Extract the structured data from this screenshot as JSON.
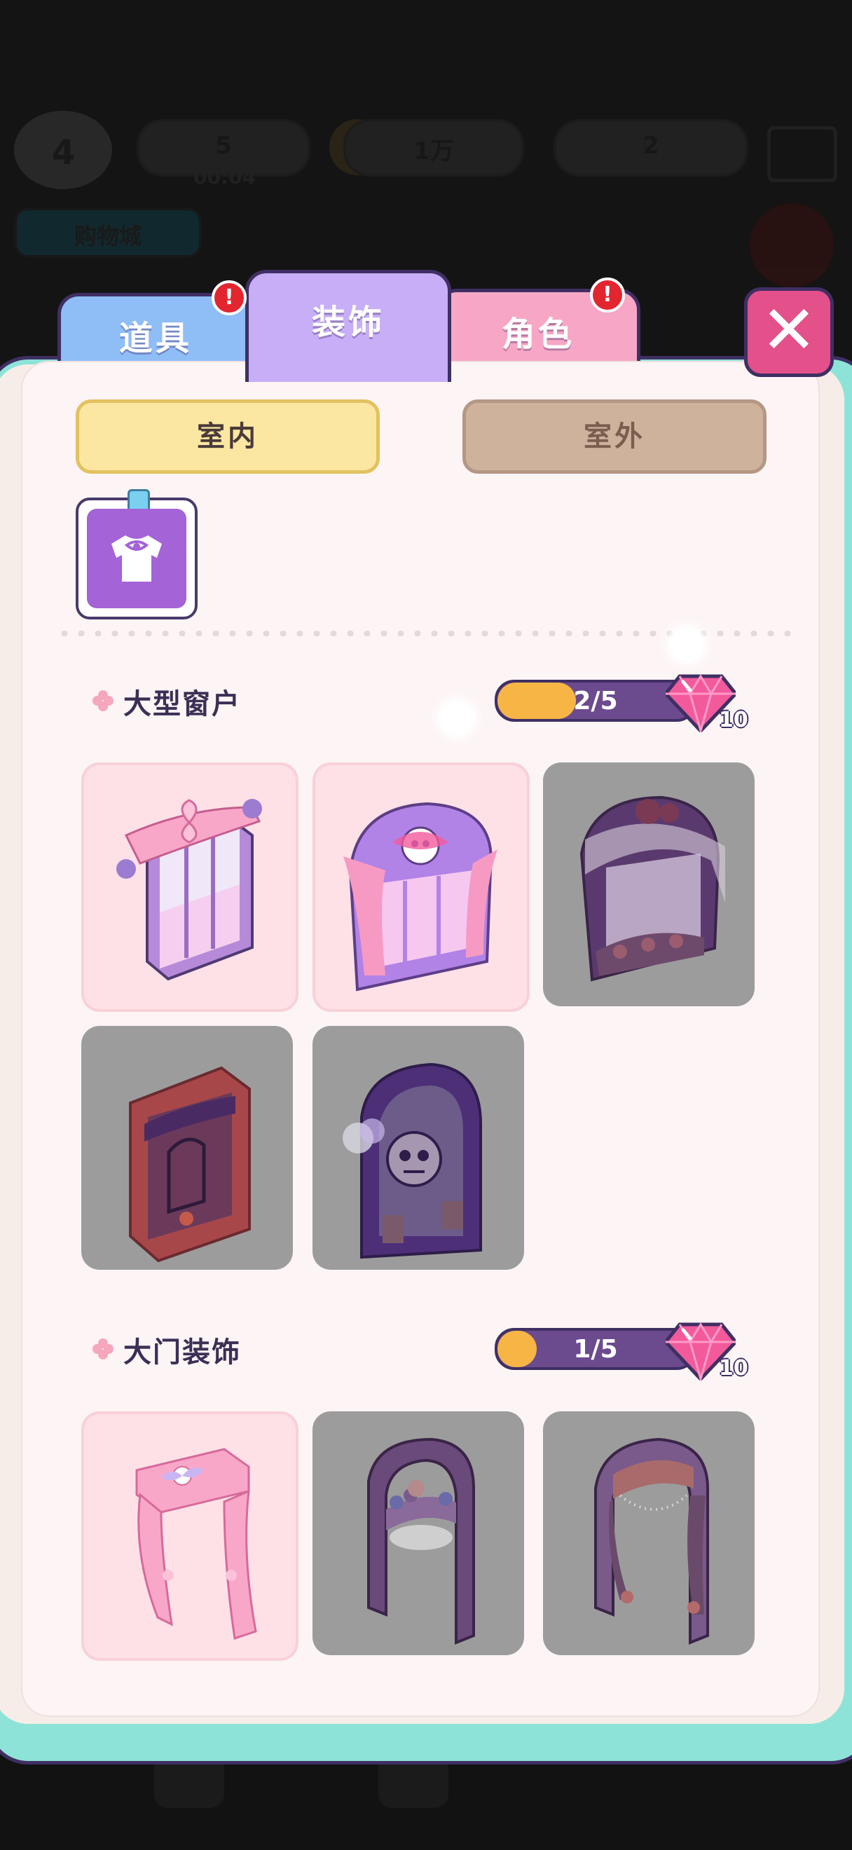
{
  "background": {
    "level": "4",
    "energy": "5",
    "energy_timer": "00:04",
    "coins": "1万",
    "gems": "2",
    "shop": "购物城"
  },
  "tabs": [
    {
      "label": "道具",
      "has_alert": true
    },
    {
      "label": "装饰",
      "active": true
    },
    {
      "label": "角色",
      "has_alert": true
    }
  ],
  "alert_mark": "!",
  "close_label": "✕",
  "subtabs": {
    "indoor": "室内",
    "outdoor": "室外"
  },
  "sections": [
    {
      "title": "大型窗户",
      "progress_text": "2/5",
      "progress_fraction": 0.4,
      "reward": "10",
      "items": [
        {
          "locked": false
        },
        {
          "locked": false
        },
        {
          "locked": true
        },
        {
          "locked": true
        },
        {
          "locked": true
        }
      ]
    },
    {
      "title": "大门装饰",
      "progress_text": "1/5",
      "progress_fraction": 0.2,
      "reward": "10",
      "items": [
        {
          "locked": false
        },
        {
          "locked": true
        },
        {
          "locked": true
        }
      ]
    }
  ],
  "colors": {
    "accent_purple": "#3f2f63",
    "progress_fill": "#f6b545",
    "gem_pink": "#f25a9c",
    "locked_card": "#9c9c9c",
    "unlocked_card": "#fde1e7"
  }
}
